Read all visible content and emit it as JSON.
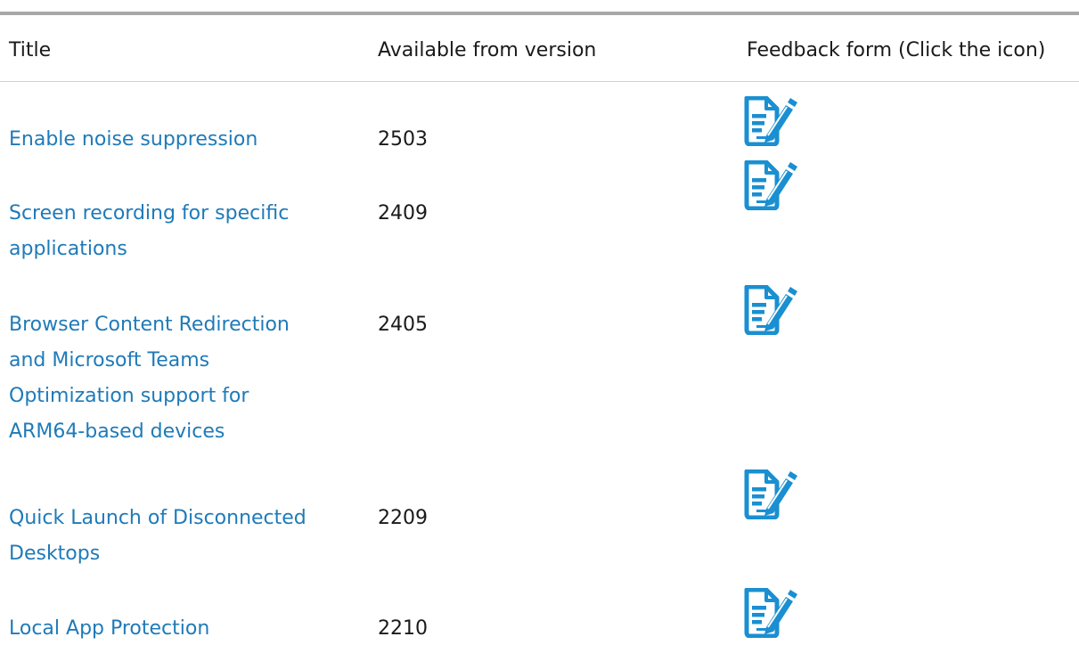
{
  "table": {
    "headers": {
      "title": "Title",
      "version": "Available from version",
      "feedback": "Feedback form (Click the icon)"
    },
    "rows": [
      {
        "title_lines": [
          "Enable noise suppression"
        ],
        "version": "2503",
        "feedback_icon": "feedback-form-icon"
      },
      {
        "title_lines": [
          "Screen recording for specific",
          "applications"
        ],
        "version": "2409",
        "feedback_icon": "feedback-form-icon"
      },
      {
        "title_lines": [
          "Browser Content Redirection",
          "and Microsoft Teams",
          "Optimization support for",
          "ARM64-based devices"
        ],
        "version": "2405",
        "feedback_icon": "feedback-form-icon"
      },
      {
        "title_lines": [
          "Quick Launch of Disconnected",
          "Desktops"
        ],
        "version": "2209",
        "feedback_icon": "feedback-form-icon"
      },
      {
        "title_lines": [
          "Local App Protection"
        ],
        "version": "2210",
        "feedback_icon": "feedback-form-icon"
      }
    ]
  },
  "colors": {
    "link": "#1f7ab8",
    "icon": "#1a8fd1",
    "text": "#1a1a1a",
    "rule": "#a8a8a8"
  }
}
